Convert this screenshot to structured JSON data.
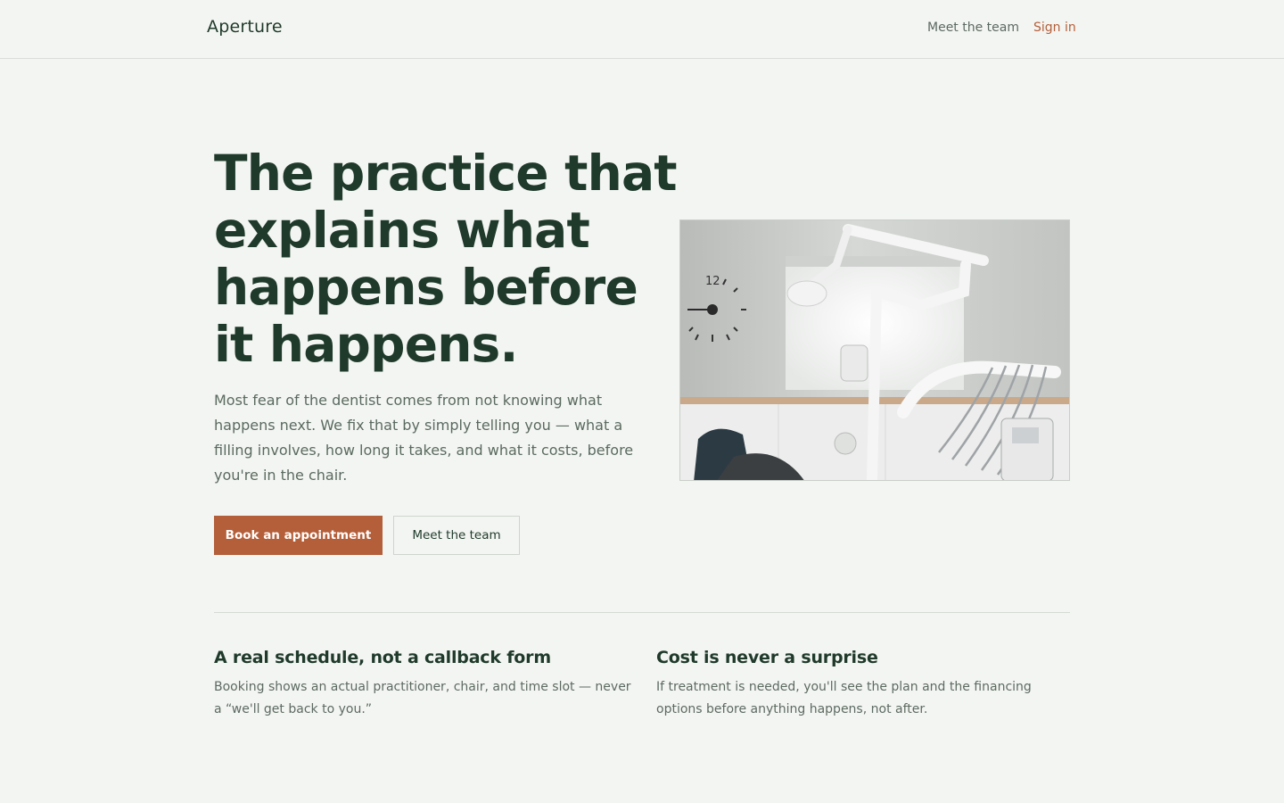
{
  "header": {
    "brand": "Aperture",
    "nav_team": "Meet the team",
    "nav_signin": "Sign in"
  },
  "hero": {
    "title": "The practice that explains what happens before it happens.",
    "lede": "Most fear of the dentist comes from not knowing what happens next. We fix that by simply telling you — what a filling involves, how long it takes, and what it costs, before you're in the chair.",
    "primary_cta": "Book an appointment",
    "secondary_cta": "Meet the team",
    "clock_label": "12"
  },
  "features": [
    {
      "title": "A real schedule, not a callback form",
      "body": "Booking shows an actual practitioner, chair, and time slot — never a “we'll get back to you.”"
    },
    {
      "title": "Cost is never a surprise",
      "body": "If treatment is needed, you'll see the plan and the financing options before anything happens, not after."
    }
  ],
  "colors": {
    "background": "#f3f5f2",
    "heading": "#1f3a2b",
    "accent": "#b45f3a",
    "muted_text": "#5a6a60"
  }
}
